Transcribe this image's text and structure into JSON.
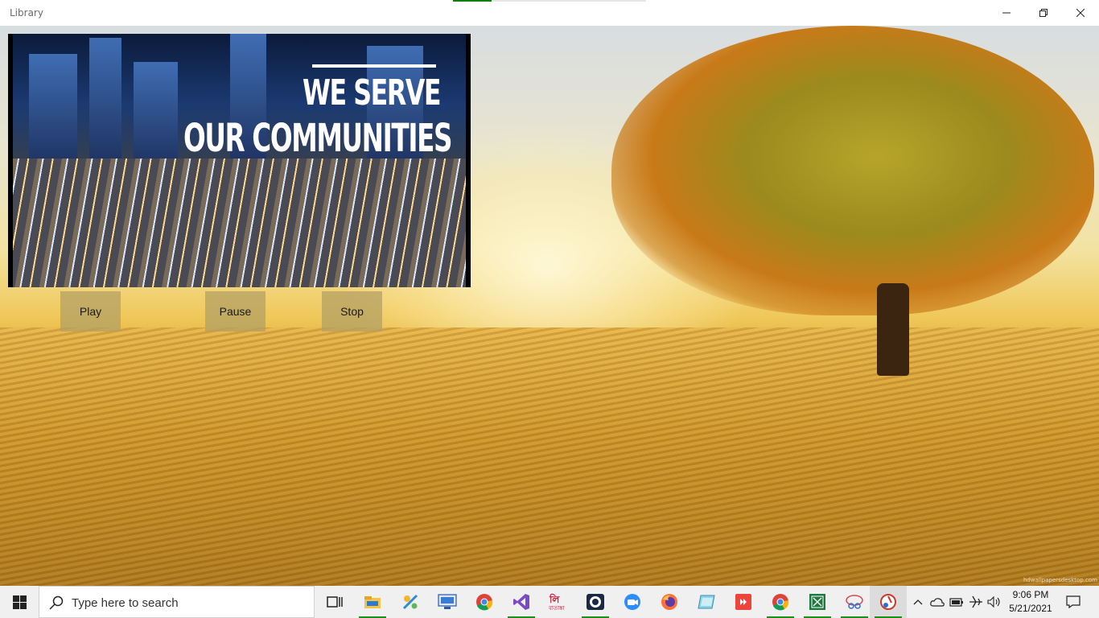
{
  "window": {
    "title": "Library",
    "load_progress": 0.2
  },
  "media": {
    "headline_line1": "WE SERVE",
    "headline_line2": "OUR COMMUNITIES"
  },
  "controls": {
    "play_label": "Play",
    "pause_label": "Pause",
    "stop_label": "Stop"
  },
  "wallpaper": {
    "watermark": "hdwallpapersdesktop.com"
  },
  "taskbar": {
    "search_placeholder": "Type here to search",
    "pinned": [
      {
        "name": "task-view-icon",
        "running": false
      },
      {
        "name": "file-explorer-icon",
        "running": true
      },
      {
        "name": "tool-icon",
        "running": false
      },
      {
        "name": "remote-desktop-icon",
        "running": false
      },
      {
        "name": "chrome-icon",
        "running": false
      },
      {
        "name": "visual-studio-icon",
        "running": true
      },
      {
        "name": "bengali-app-icon",
        "running": false
      },
      {
        "name": "camera-app-icon",
        "running": true
      },
      {
        "name": "zoom-icon",
        "running": false
      },
      {
        "name": "firefox-icon",
        "running": false
      },
      {
        "name": "notes-icon",
        "running": false
      },
      {
        "name": "anydesk-icon",
        "running": false
      },
      {
        "name": "chrome-alt-icon",
        "running": true
      },
      {
        "name": "excel-icon",
        "running": true
      },
      {
        "name": "snipping-icon",
        "running": true
      },
      {
        "name": "library-app-icon",
        "running": true
      }
    ],
    "time": "9:06 PM",
    "date": "5/21/2021"
  },
  "colors": {
    "titlebar_bg": "#ffffff",
    "taskbar_bg": "#f0f0f0",
    "running_indicator": "#1a8f1a",
    "button_bg": "#b4a064"
  }
}
